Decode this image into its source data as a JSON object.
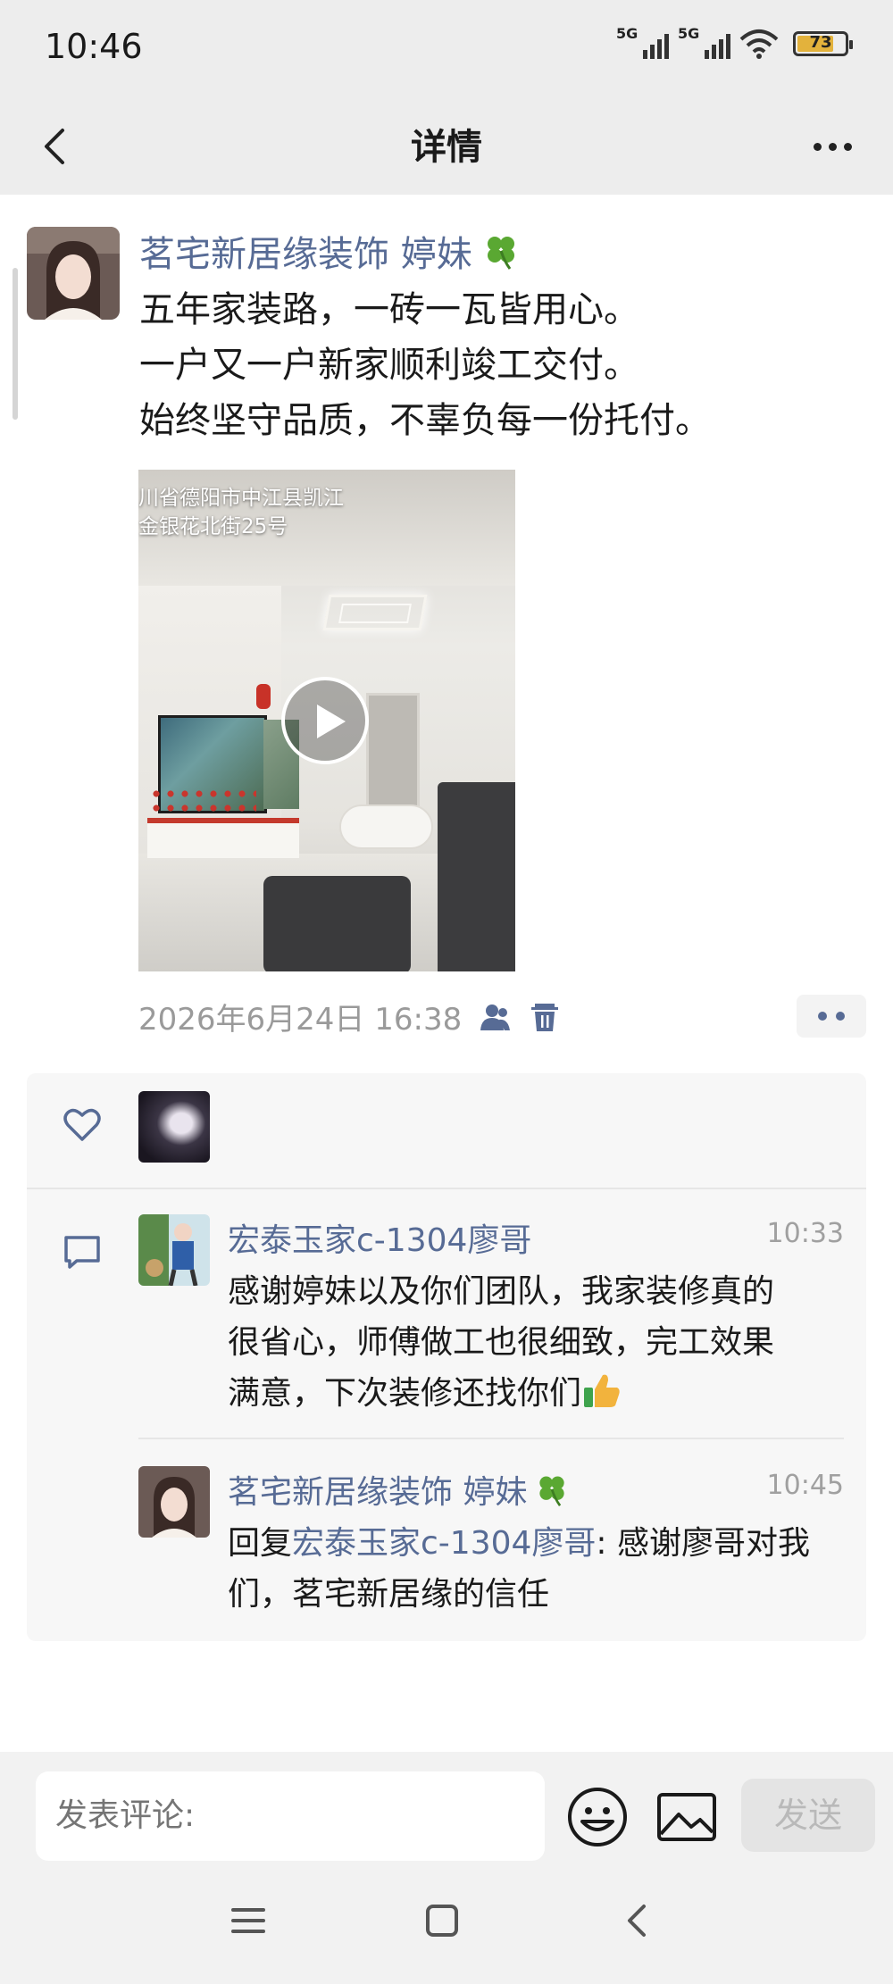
{
  "status_bar": {
    "time": "10:46",
    "network1": "5G",
    "network2": "5G",
    "battery": "73"
  },
  "nav": {
    "title": "详情"
  },
  "post": {
    "author": "茗宅新居缘装饰 婷妹",
    "lines": [
      "五年家装路，一砖一瓦皆用心。",
      "一户又一户新家顺利竣工交付。",
      "始终坚守品质，不辜负每一份托付。"
    ],
    "video_caption_line1": "川省德阳市中江县凯江",
    "video_caption_line2": "金银花北街25号",
    "timestamp": "2026年6月24日 16:38"
  },
  "comments": [
    {
      "name": "宏泰玉家c-1304廖哥",
      "time": "10:33",
      "lines": [
        "感谢婷妹以及你们团队，我家装修真的",
        "很省心，师傅做工也很细致，完工效果",
        "满意，下次装修还找你们"
      ]
    },
    {
      "name": "茗宅新居缘装饰 婷妹",
      "time": "10:45",
      "reply_prefix": "回复",
      "reply_to": "宏泰玉家c-1304廖哥",
      "line1_rest": ": 感谢廖哥对我",
      "line2": "们，茗宅新居缘的信任"
    }
  ],
  "input_bar": {
    "placeholder": "发表评论:",
    "send_label": "发送"
  },
  "colors": {
    "link": "#576b95",
    "bar_bg": "#ededed",
    "panel_bg": "#f7f7f7"
  }
}
